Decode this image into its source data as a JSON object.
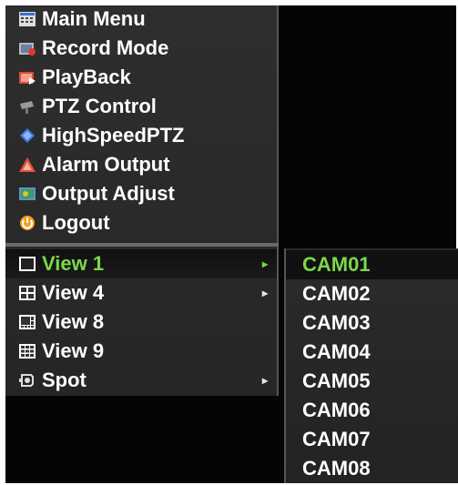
{
  "main_menu": {
    "items": [
      {
        "label": "Main Menu",
        "icon": "main-menu-icon"
      },
      {
        "label": "Record Mode",
        "icon": "record-mode-icon"
      },
      {
        "label": "PlayBack",
        "icon": "playback-icon"
      },
      {
        "label": "PTZ Control",
        "icon": "ptz-camera-icon"
      },
      {
        "label": "HighSpeedPTZ",
        "icon": "diamond-icon"
      },
      {
        "label": "Alarm Output",
        "icon": "alarm-triangle-icon"
      },
      {
        "label": "Output Adjust",
        "icon": "output-adjust-icon"
      },
      {
        "label": "Logout",
        "icon": "power-icon"
      }
    ]
  },
  "view_menu": {
    "items": [
      {
        "label": "View 1",
        "icon": "single-view-icon",
        "selected": true,
        "has_submenu": true
      },
      {
        "label": "View 4",
        "icon": "quad-view-icon",
        "has_submenu": true
      },
      {
        "label": "View 8",
        "icon": "eight-view-icon",
        "has_submenu": false
      },
      {
        "label": "View 9",
        "icon": "nine-view-icon",
        "has_submenu": false
      },
      {
        "label": "Spot",
        "icon": "spot-icon",
        "has_submenu": true
      }
    ],
    "arrow_glyph": "▸"
  },
  "camera_submenu": {
    "items": [
      "CAM01",
      "CAM02",
      "CAM03",
      "CAM04",
      "CAM05",
      "CAM06",
      "CAM07",
      "CAM08"
    ],
    "selected_index": 0
  },
  "colors": {
    "selected_text": "#7ad84a",
    "menu_bg": "#2a2a2a",
    "screen_bg": "#050505"
  }
}
